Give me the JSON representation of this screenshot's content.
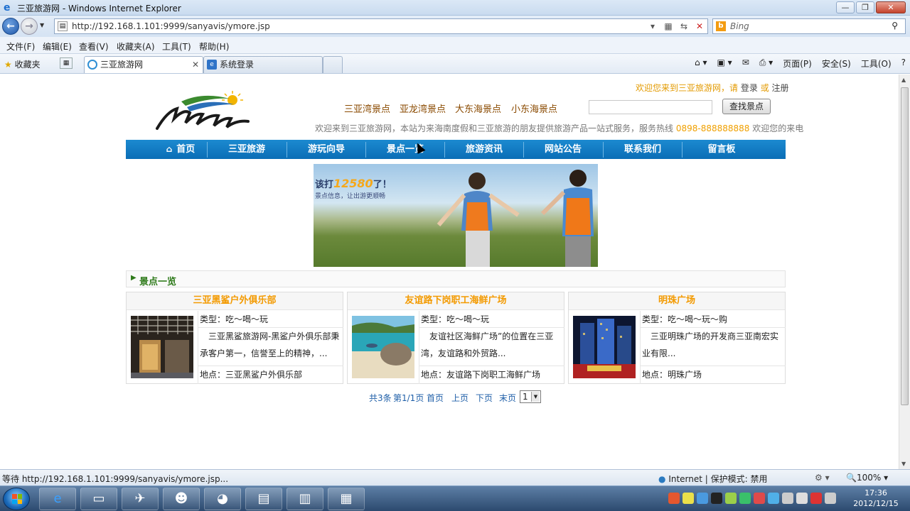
{
  "window": {
    "title": "三亚旅游网 - Windows Internet Explorer"
  },
  "address": {
    "url": "http://192.168.1.101:9999/sanyavis/ymore.jsp",
    "search_placeholder": "Bing"
  },
  "menu": [
    "文件(F)",
    "编辑(E)",
    "查看(V)",
    "收藏夹(A)",
    "工具(T)",
    "帮助(H)"
  ],
  "favorites_label": "收藏夹",
  "tabs": [
    {
      "label": "三亚旅游网"
    },
    {
      "label": "系统登录"
    }
  ],
  "command_bar": [
    "页面(P)",
    "安全(S)",
    "工具(O)"
  ],
  "page": {
    "welcome": {
      "text": "欢迎您来到三亚旅游网，请",
      "login": "登录",
      "or": "或",
      "register": "注册"
    },
    "top_links": [
      "三亚湾景点",
      "亚龙湾景点",
      "大东海景点",
      "小东海景点"
    ],
    "search_button": "查找景点",
    "intro": {
      "text": "欢迎来到三亚旅游网，本站为来海南度假和三亚旅游的朋友提供旅游产品一站式服务，服务热线",
      "phone": "0898-888888888",
      "tail": "欢迎您的来电"
    },
    "nav": [
      "首页",
      "三亚旅游",
      "游玩向导",
      "景点一览",
      "旅游资讯",
      "网站公告",
      "联系我们",
      "留言板"
    ],
    "banner": {
      "text1": "该打",
      "num": "12580",
      "text2": "了！",
      "sub": "景点信息，让出游更顺畅"
    },
    "section_title": "景点一览",
    "cards": [
      {
        "title": "三亚黑鲨户外俱乐部",
        "type": "类型：吃～喝～玩",
        "desc": "三亚黑鲨旅游网-黑鲨户外俱乐部秉承客户第一，信誉至上的精神，...",
        "location": "地点：三亚黑鲨户外俱乐部"
      },
      {
        "title": "友谊路下岗职工海鲜广场",
        "type": "类型：吃～喝～玩",
        "desc": "友谊社区海鲜广场”的位置在三亚湾，友谊路和外贸路...",
        "location": "地点：友谊路下岗职工海鲜广场"
      },
      {
        "title": "明珠广场",
        "type": "类型：吃～喝～玩～购",
        "desc": "三亚明珠广场的开发商三亚南宏实业有限...",
        "location": "地点：明珠广场"
      }
    ],
    "pager": {
      "total": "共3条",
      "page": "第1/1页",
      "first": "首页",
      "prev": "上页",
      "next": "下页",
      "last": "末页",
      "select_value": "1"
    }
  },
  "status": {
    "text": "等待 http://192.168.1.101:9999/sanyavis/ymore.jsp...",
    "zone": "Internet | 保护模式: 禁用",
    "zoom": "100%"
  },
  "clock": {
    "time": "17:36",
    "date": "2012/12/15"
  }
}
